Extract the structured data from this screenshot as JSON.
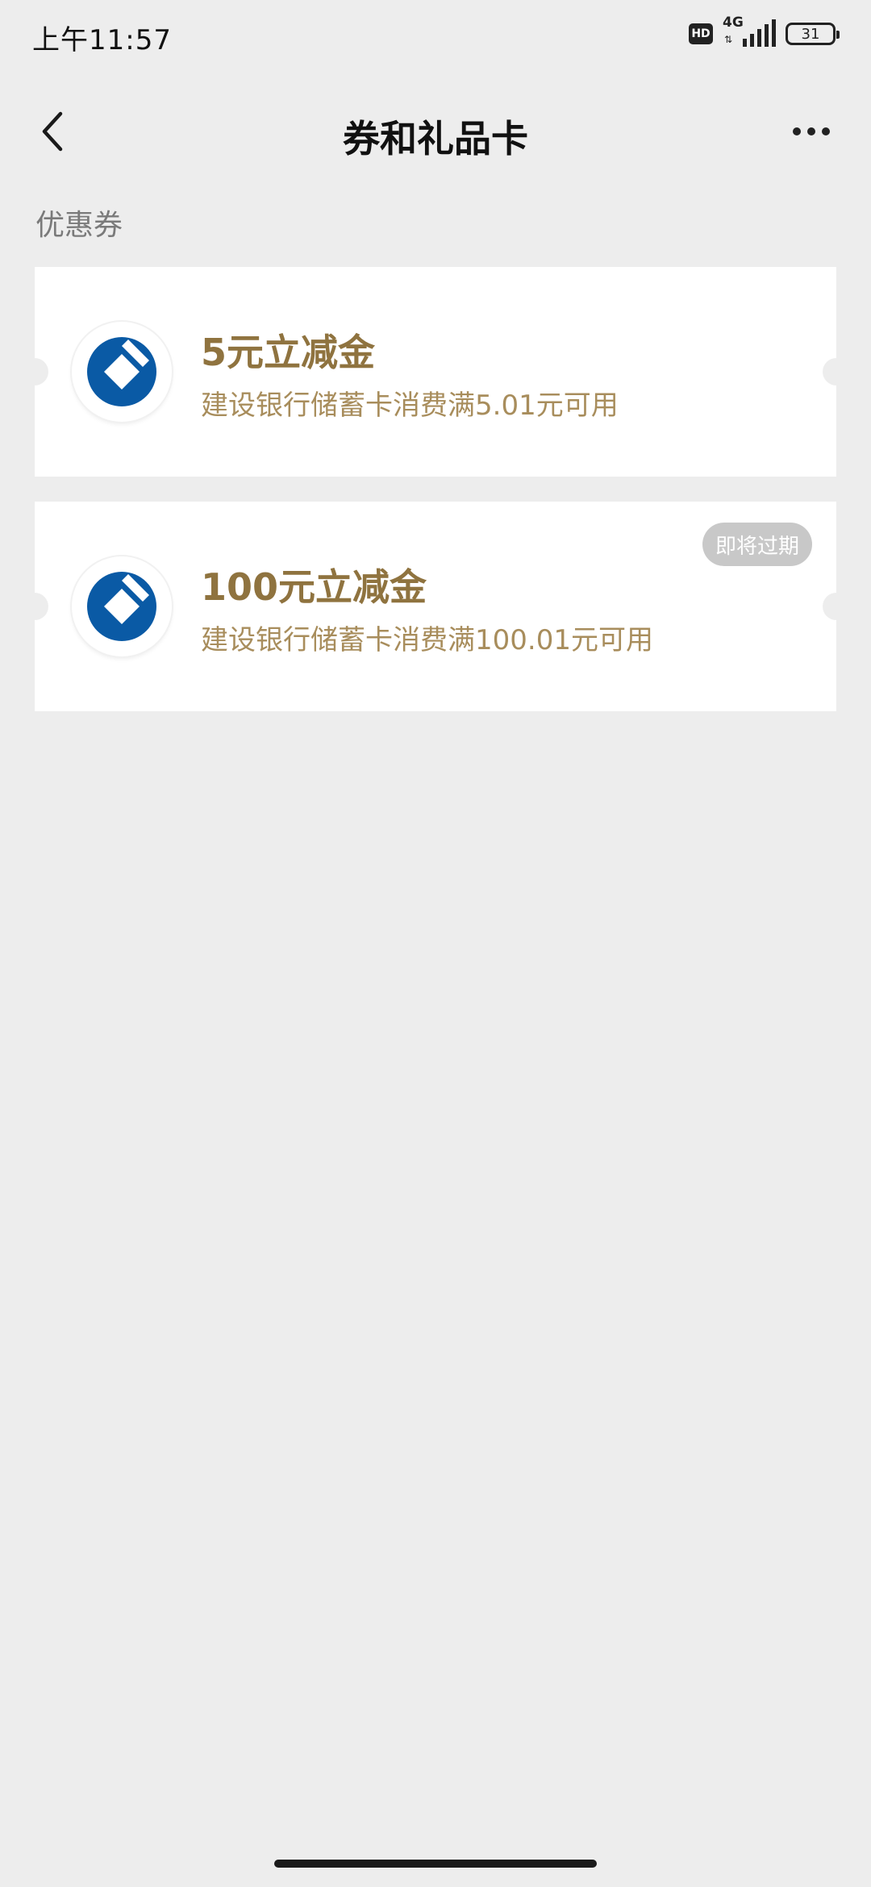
{
  "status_bar": {
    "time": "上午11:57",
    "hd": "HD",
    "network": "4G",
    "battery": "31"
  },
  "header": {
    "title": "券和礼品卡",
    "back_icon": "chevron-left-icon",
    "more_icon": "more-horizontal-icon"
  },
  "section": {
    "label": "优惠券"
  },
  "coupons": [
    {
      "title": "5元立减金",
      "description": "建设银行储蓄卡消费满5.01元可用",
      "logo": "ccb-bank-logo"
    },
    {
      "title": "100元立减金",
      "description": "建设银行储蓄卡消费满100.01元可用",
      "badge": "即将过期",
      "logo": "ccb-bank-logo"
    }
  ],
  "colors": {
    "background": "#ededed",
    "coupon_title": "#8f733f",
    "coupon_desc": "#a88d5c",
    "bank_blue": "#0a5aa5",
    "badge_bg": "#c8c8c8"
  }
}
